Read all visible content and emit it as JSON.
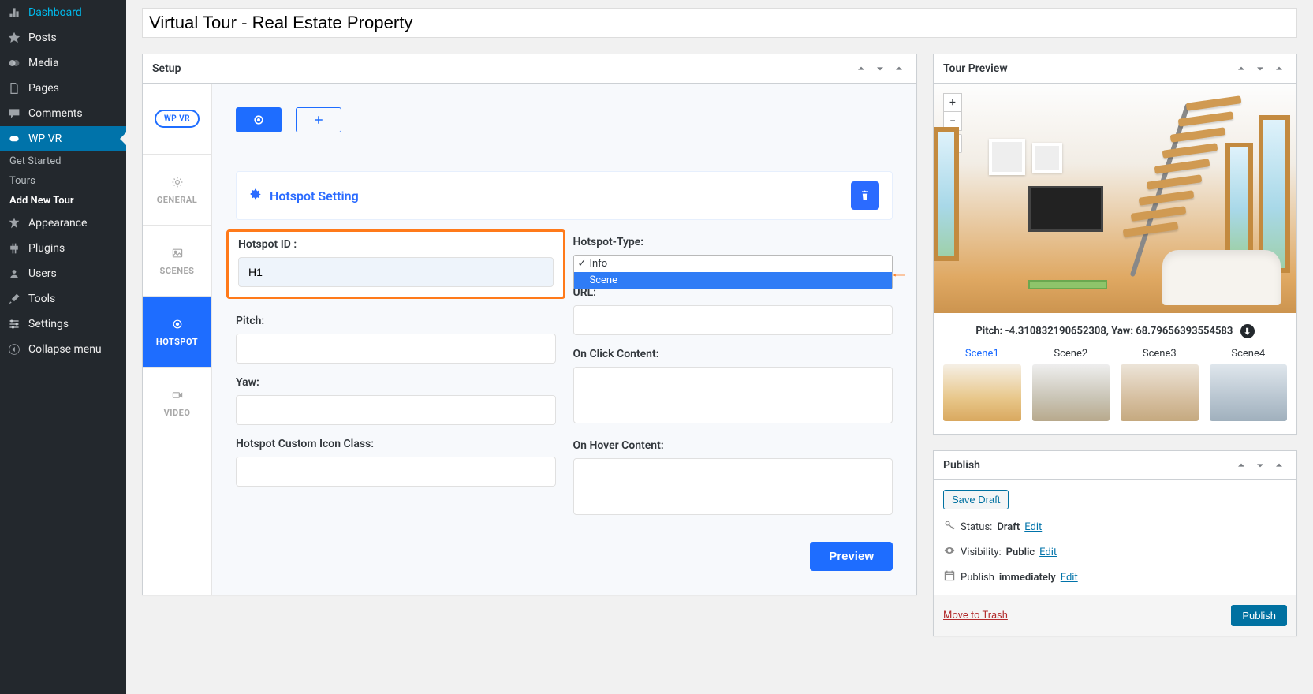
{
  "admin_menu": {
    "items": [
      {
        "icon": "dashboard",
        "label": "Dashboard"
      },
      {
        "icon": "pin",
        "label": "Posts"
      },
      {
        "icon": "media",
        "label": "Media"
      },
      {
        "icon": "page",
        "label": "Pages"
      },
      {
        "icon": "comment",
        "label": "Comments"
      },
      {
        "icon": "wpvr",
        "label": "WP VR",
        "active": true
      },
      {
        "icon": "appearance",
        "label": "Appearance"
      },
      {
        "icon": "plugins",
        "label": "Plugins"
      },
      {
        "icon": "users",
        "label": "Users"
      },
      {
        "icon": "tools",
        "label": "Tools"
      },
      {
        "icon": "settings",
        "label": "Settings"
      },
      {
        "icon": "collapse",
        "label": "Collapse menu"
      }
    ],
    "wpvr_submenu": [
      {
        "label": "Get Started"
      },
      {
        "label": "Tours"
      },
      {
        "label": "Add New Tour",
        "current": true
      }
    ]
  },
  "page_title": "Virtual Tour - Real Estate Property",
  "setup_panel": {
    "header": "Setup",
    "logo_text": "WP VR",
    "tabs": [
      {
        "id": "general",
        "label": "GENERAL"
      },
      {
        "id": "scenes",
        "label": "SCENES"
      },
      {
        "id": "hotspot",
        "label": "HOTSPOT",
        "active": true
      },
      {
        "id": "video",
        "label": "VIDEO"
      }
    ],
    "setting_title": "Hotspot Setting",
    "fields": {
      "hotspot_id_label": "Hotspot ID :",
      "hotspot_id_value": "H1",
      "hotspot_type_label": "Hotspot-Type:",
      "hotspot_type_options": [
        "Info",
        "Scene"
      ],
      "hotspot_type_selected": "Info",
      "hotspot_type_hover": "Scene",
      "pitch_label": "Pitch:",
      "pitch_value": "",
      "yaw_label": "Yaw:",
      "yaw_value": "",
      "icon_class_label": "Hotspot Custom Icon Class:",
      "icon_class_value": "",
      "url_label": "URL:",
      "url_value": "",
      "onclick_label": "On Click Content:",
      "onclick_value": "",
      "onhover_label": "On Hover Content:",
      "onhover_value": ""
    },
    "preview_button": "Preview"
  },
  "tour_preview": {
    "header": "Tour Preview",
    "pitch_yaw_text": "Pitch: -4.310832190652308, Yaw: 68.79656393554583",
    "scenes": [
      {
        "name": "Scene1",
        "active": true
      },
      {
        "name": "Scene2"
      },
      {
        "name": "Scene3"
      },
      {
        "name": "Scene4"
      }
    ]
  },
  "publish": {
    "header": "Publish",
    "save_draft": "Save Draft",
    "status_label": "Status:",
    "status_value": "Draft",
    "visibility_label": "Visibility:",
    "visibility_value": "Public",
    "schedule_label": "Publish",
    "schedule_value": "immediately",
    "edit_link": "Edit",
    "trash_link": "Move to Trash",
    "publish_button": "Publish"
  }
}
